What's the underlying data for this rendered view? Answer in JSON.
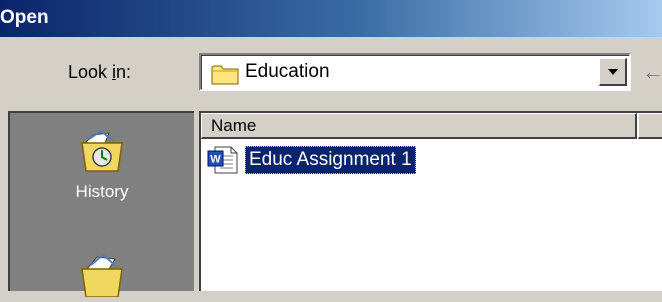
{
  "window": {
    "title": "Open"
  },
  "look_in": {
    "label": "Look in:",
    "selected": "Education",
    "icon": "folder-icon"
  },
  "places_bar": {
    "items": [
      {
        "label": "History",
        "icon": "history-icon"
      },
      {
        "label": "",
        "icon": "my-documents-icon"
      }
    ]
  },
  "file_list": {
    "columns": [
      "Name",
      ""
    ],
    "files": [
      {
        "name": "Educ Assignment 1",
        "icon": "word-document-icon",
        "selected": true
      }
    ]
  },
  "colors": {
    "title_bar": "#0a246a",
    "selection": "#0a246a",
    "dialog_bg": "#d4d0c8",
    "places_bg": "#808080"
  }
}
